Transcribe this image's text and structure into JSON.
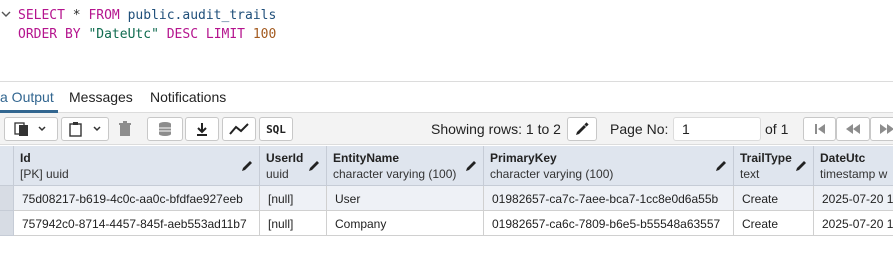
{
  "editor": {
    "line1": {
      "kw1": "SELECT",
      "star": " * ",
      "kw2": "FROM",
      "ident": " public.audit_trails"
    },
    "line2": {
      "kw1": "ORDER BY",
      "str": " \"DateUtc\"",
      "kw2": " DESC LIMIT",
      "num": " 100"
    }
  },
  "tabs": [
    {
      "label": "a Output"
    },
    {
      "label": "Messages"
    },
    {
      "label": "Notifications"
    }
  ],
  "toolbar": {
    "sql_label": "SQL",
    "rows_status": "Showing rows: 1 to 2",
    "page_label": "Page No:",
    "page_value": "1",
    "page_of": "of 1"
  },
  "grid": {
    "columns": [
      {
        "name": "Id",
        "type": "[PK] uuid"
      },
      {
        "name": "UserId",
        "type": "uuid"
      },
      {
        "name": "EntityName",
        "type": "character varying (100)"
      },
      {
        "name": "PrimaryKey",
        "type": "character varying (100)"
      },
      {
        "name": "TrailType",
        "type": "text"
      },
      {
        "name": "DateUtc",
        "type": "timestamp w"
      }
    ],
    "rows": [
      [
        "75d08217-b619-4c0c-aa0c-bfdfae927eeb",
        "[null]",
        "User",
        "01982657-ca7c-7aee-bca7-1cc8e0d6a55b",
        "Create",
        "2025-07-20 1"
      ],
      [
        "757942c0-8714-4457-845f-aeb553ad11b7",
        "[null]",
        "Company",
        "01982657-ca6c-7809-b6e5-b55548a63557",
        "Create",
        "2025-07-20 1"
      ]
    ]
  }
}
